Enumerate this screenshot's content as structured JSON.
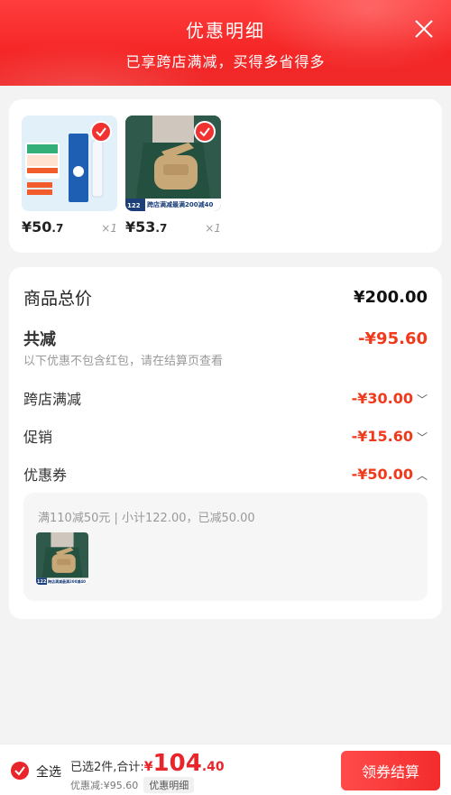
{
  "header": {
    "title": "优惠明细",
    "subtitle": "已享跨店满减，买得多省得多"
  },
  "products": [
    {
      "price_int": "¥50",
      "price_dec": ".7",
      "qty": "×1",
      "badge_lines": [
        "五一特惠",
        "健康无忧",
        "¥64.6"
      ],
      "brand_text": "NUTRITION"
    },
    {
      "price_int": "¥53",
      "price_dec": ".7",
      "qty": "×1",
      "banner_price": "122",
      "banner_text": "跨店满减最满200减40"
    }
  ],
  "details": {
    "total_label": "商品总价",
    "total_value": "¥200.00",
    "reduce_label": "共减",
    "reduce_value": "-¥95.60",
    "note": "以下优惠不包含红包，请在结算页查看",
    "items": [
      {
        "label": "跨店满减",
        "value": "-¥30.00",
        "chevron": "chevron-down-icon"
      },
      {
        "label": "促销",
        "value": "-¥15.60",
        "chevron": "chevron-down-icon"
      },
      {
        "label": "优惠券",
        "value": "-¥50.00",
        "chevron": "chevron-up-icon"
      }
    ],
    "coupon": {
      "info": "满110减50元 | 小计122.00，已减50.00",
      "thumb_price": "122",
      "thumb_banner": "跨店满减最满200减40"
    }
  },
  "footer": {
    "select_all": "全选",
    "summary_prefix": "已选2件,合计:",
    "total_currency": "¥",
    "total_int": "104",
    "total_dec": ".40",
    "reduced_text": "优惠减:¥95.60",
    "detail_tag": "优惠明细",
    "checkout_label": "领券结算"
  },
  "colors": {
    "brand_red": "#f23131",
    "price_red": "#f1391c"
  }
}
